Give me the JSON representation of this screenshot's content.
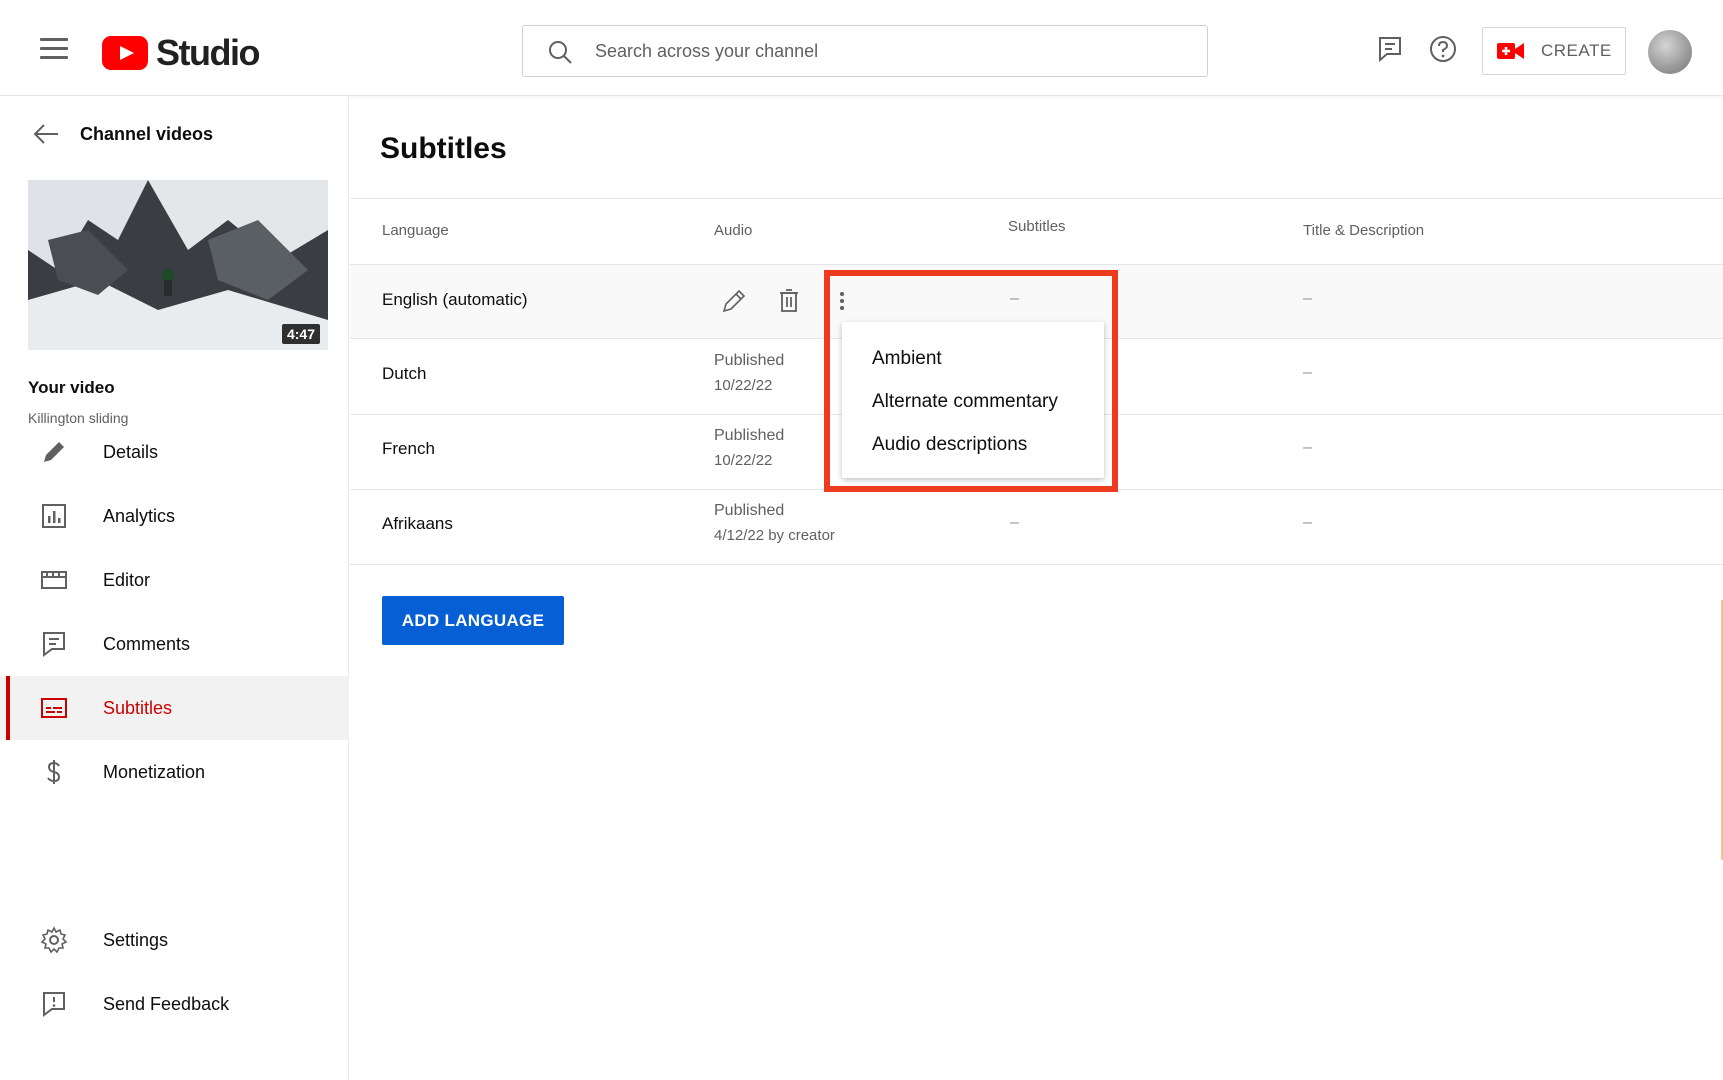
{
  "header": {
    "logo_text": "Studio",
    "search_placeholder": "Search across your channel",
    "create_label": "CREATE"
  },
  "sidebar": {
    "back_label": "Channel videos",
    "thumbnail_duration": "4:47",
    "your_video_label": "Your video",
    "video_title": "Killington sliding",
    "items": [
      {
        "label": "Details",
        "icon": "pencil-icon"
      },
      {
        "label": "Analytics",
        "icon": "analytics-icon"
      },
      {
        "label": "Editor",
        "icon": "editor-icon"
      },
      {
        "label": "Comments",
        "icon": "comments-icon"
      },
      {
        "label": "Subtitles",
        "icon": "subtitles-icon",
        "active": true
      },
      {
        "label": "Monetization",
        "icon": "dollar-icon"
      },
      {
        "label": "Settings",
        "icon": "gear-icon"
      },
      {
        "label": "Send Feedback",
        "icon": "feedback-icon"
      }
    ]
  },
  "main": {
    "page_title": "Subtitles",
    "columns": {
      "language": "Language",
      "audio": "Audio",
      "subtitles": "Subtitles",
      "title_description": "Title & Description"
    },
    "rows": [
      {
        "language": "English (automatic)",
        "audio_status": "",
        "audio_date": "",
        "subtitles": "–",
        "title_description": "–"
      },
      {
        "language": "Dutch",
        "audio_status": "Published",
        "audio_date": "10/22/22",
        "subtitles": "",
        "title_description": "–"
      },
      {
        "language": "French",
        "audio_status": "Published",
        "audio_date": "10/22/22",
        "subtitles": "",
        "title_description": "–"
      },
      {
        "language": "Afrikaans",
        "audio_status": "Published",
        "audio_date": "4/12/22 by creator",
        "subtitles": "–",
        "title_description": "–"
      }
    ],
    "add_language_label": "ADD LANGUAGE"
  },
  "menu": {
    "items": [
      "Ambient",
      "Alternate commentary",
      "Audio descriptions"
    ]
  },
  "colors": {
    "brand_red": "#ff0000",
    "active_red": "#cc0000",
    "button_blue": "#065fd4",
    "highlight_red": "#ee3a1e"
  }
}
